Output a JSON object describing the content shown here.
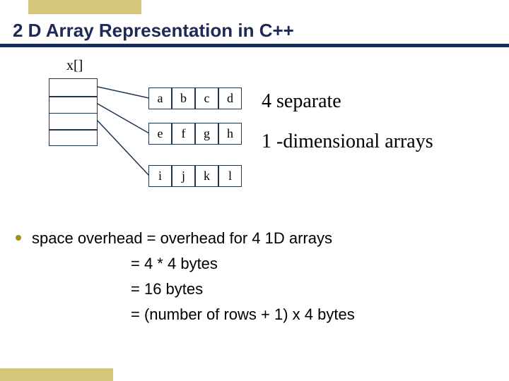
{
  "title": "2 D Array Representation in C++",
  "pointer_label": "x[]",
  "rows": [
    {
      "cells": [
        "a",
        "b",
        "c",
        "d"
      ]
    },
    {
      "cells": [
        "e",
        "f",
        "g",
        "h"
      ]
    },
    {
      "cells": [
        "i",
        "j",
        "k",
        "l"
      ]
    }
  ],
  "caption_line1": "4 separate",
  "caption_line2": "1 -dimensional arrays",
  "bullet": {
    "line1": "space overhead = overhead for 4 1D arrays",
    "line2": "= 4 * 4 bytes",
    "line3": "= 16 bytes",
    "line4": "= (number of rows + 1) x 4 bytes"
  }
}
